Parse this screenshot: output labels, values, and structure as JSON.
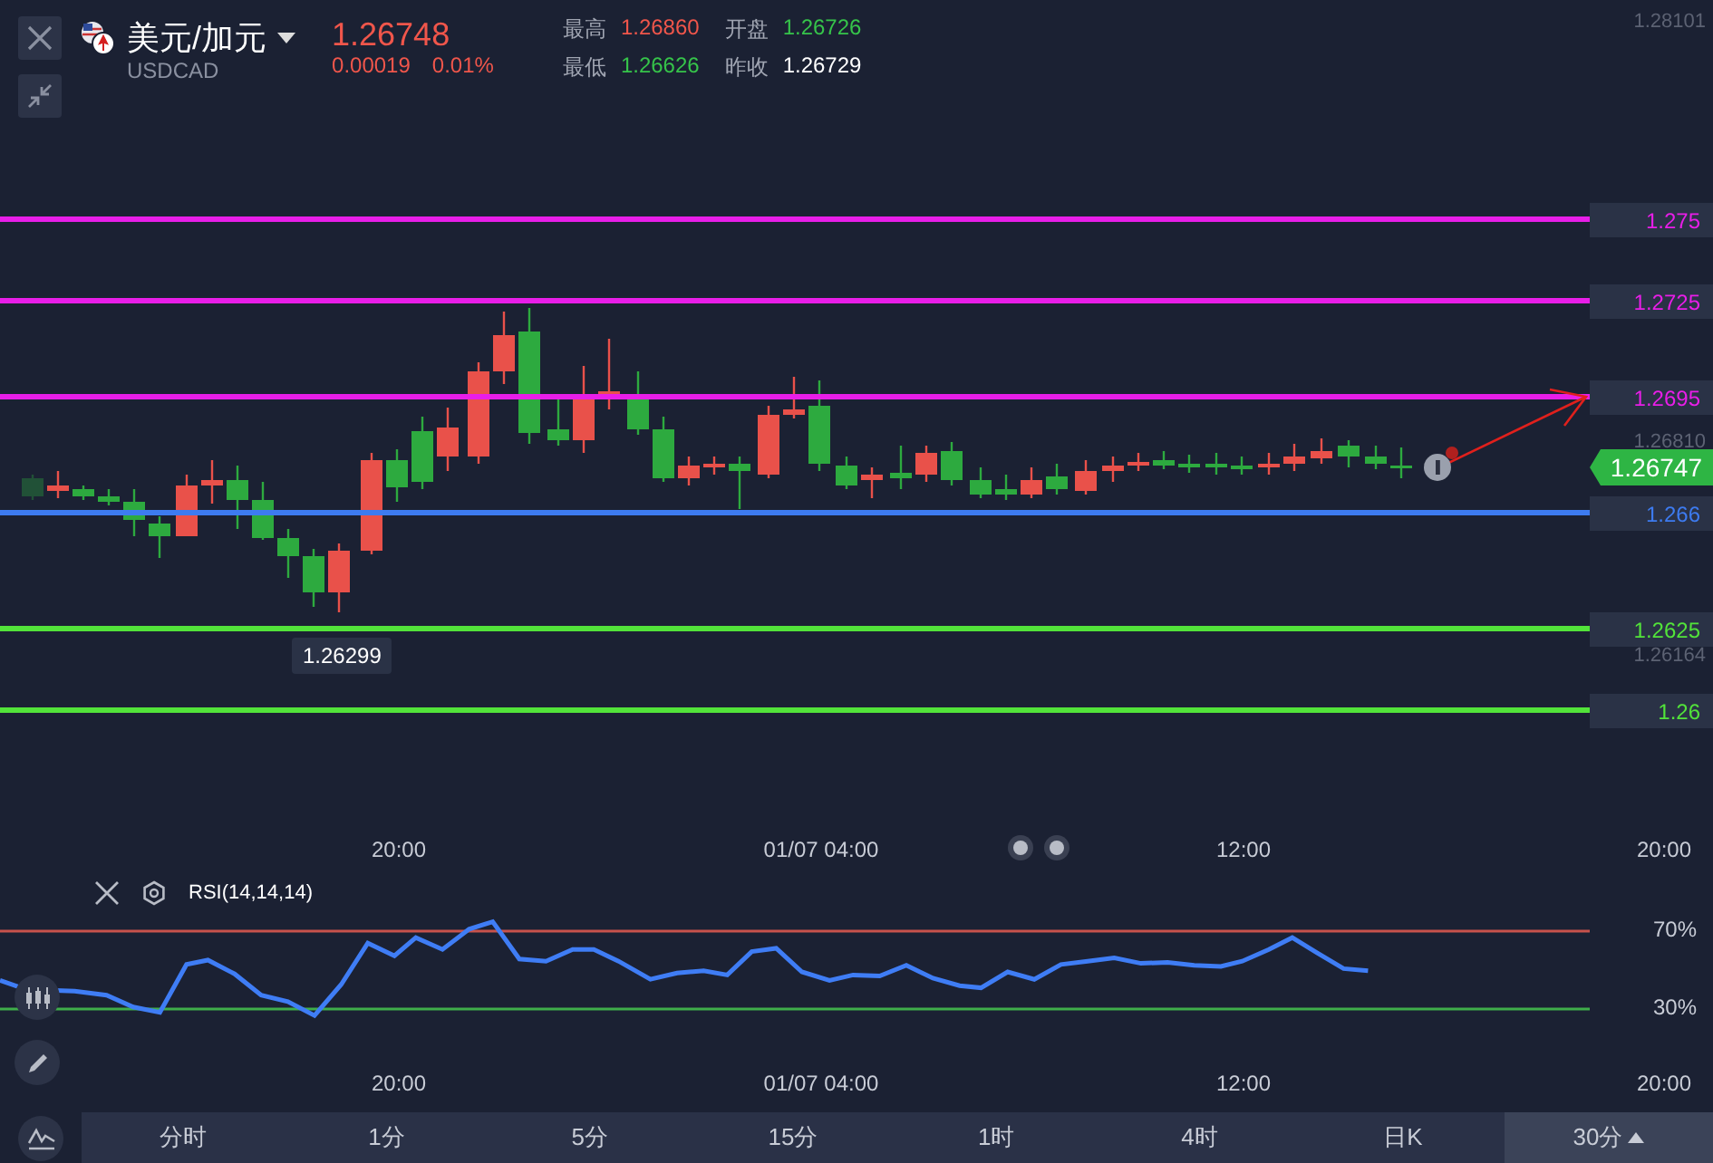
{
  "instrument": {
    "name": "美元/加元",
    "code": "USDCAD",
    "price": "1.26748",
    "color": "#f0564b",
    "change": "0.00019",
    "change_percent": "0.01%"
  },
  "stats": [
    {
      "label": "最高",
      "value": "1.26860",
      "color": "#f0564b"
    },
    {
      "label": "开盘",
      "value": "1.26726",
      "color": "#36c44a"
    },
    {
      "label": "最低",
      "value": "1.26626",
      "color": "#36c44a"
    },
    {
      "label": "昨收",
      "value": "1.26729",
      "color": "#ffffff"
    }
  ],
  "price_axis": [
    "1.28101",
    "1.26810",
    "1.26164"
  ],
  "price_lines": [
    {
      "label": "1.275",
      "color": "#e81ee8"
    },
    {
      "label": "1.2725",
      "color": "#e81ee8"
    },
    {
      "label": "1.2695",
      "color": "#e81ee8"
    },
    {
      "label": "1.266",
      "color": "#3d7bf0"
    },
    {
      "label": "1.2625",
      "color": "#52e33a"
    },
    {
      "label": "1.26",
      "color": "#52e33a"
    }
  ],
  "current_price": "1.26747",
  "low_marker": "1.26299",
  "time_axis": [
    "20:00",
    "01/07 04:00",
    "12:00",
    "20:00"
  ],
  "rsi": {
    "title": "RSI(14,14,14)",
    "levels": [
      {
        "label": "70%",
        "color": "#c8524c"
      },
      {
        "label": "30%",
        "color": "#3fae4a"
      }
    ],
    "time_axis": [
      "20:00",
      "01/07 04:00",
      "12:00",
      "20:00"
    ]
  },
  "timeframes": [
    {
      "label": "分时",
      "selected": false
    },
    {
      "label": "1分",
      "selected": false
    },
    {
      "label": "5分",
      "selected": false
    },
    {
      "label": "15分",
      "selected": false
    },
    {
      "label": "1时",
      "selected": false
    },
    {
      "label": "4时",
      "selected": false
    },
    {
      "label": "日K",
      "selected": false
    },
    {
      "label": "30分",
      "selected": true
    }
  ]
}
